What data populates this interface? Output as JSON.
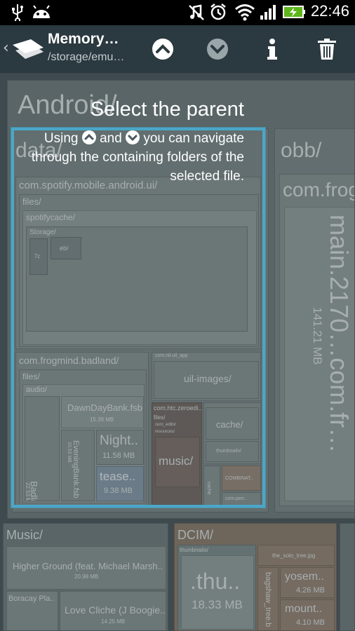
{
  "status_bar": {
    "time": "22:46"
  },
  "action_bar": {
    "title": "Memory…",
    "subtitle": "/storage/emu…"
  },
  "treemap": {
    "android": "Android/",
    "data": "data/",
    "obb": "obb/",
    "obb_child": "com.frog",
    "main_file": "main.2170…com.fr…",
    "main_size": "141.21 MB",
    "spotify": "com.spotify.mobile.android.ui/",
    "files": "files/",
    "spotifycache": "spotifycache/",
    "storage": "Storage/",
    "sp_7c": "7c",
    "sp_eb": "eb/",
    "badland": "com.frogmind.badland/",
    "bl_files": "files/",
    "audio": "audio/",
    "badland_fsb": "BadlandBank.fsb",
    "badland_size": "22.53 MB",
    "dawnday": "DawnDayBank.fsb",
    "dawnday_size": "15.39 MB",
    "evening": "EveningBank.fsb",
    "evening_size": "10.53 MB",
    "night": "Night..",
    "night_size": "11.58 MB",
    "tease": "tease..",
    "tease_size": "9.38 MB",
    "uil_app": "com.nil.uil_app",
    "uil_images": "uil-images/",
    "htc": "com.htc.zeroedi..",
    "htc_files": "files/",
    "zero_editor": "zero_editor",
    "resources": "resources/",
    "music_folder": "music/",
    "cache": "cache/",
    "thumbnails": "thumbnails/",
    "combinat": "COMBINAT..",
    "cache2": "cache",
    "peri": "com.peri..",
    "music": "Music/",
    "higher_ground": "Higher Ground (feat. Michael Marsh..",
    "higher_size": "20.98 MB",
    "boracay": "Boracay Pla..",
    "love_cliche": "Love Cliche (J Boogie..",
    "love_size": "14.25 MB",
    "dcim": "DCIM/",
    "thumbnails2": "thumbnails/",
    "thu": ".thu..",
    "thu_size": "18.33 MB",
    "solo_tree": "the_solo_tree.jpg",
    "bagshaw": "bagshaw_tree.b",
    "yosem": "yosem..",
    "yosem_size": "4.26 MB",
    "mount": "mount..",
    "mount_size": "4.10 MB"
  },
  "hint": {
    "title": "Select the parent",
    "line1_pre": "Using",
    "line1_mid": "and",
    "line1_post": "you can navigate",
    "line2": "through the containing folders of the",
    "line3": "selected file."
  }
}
